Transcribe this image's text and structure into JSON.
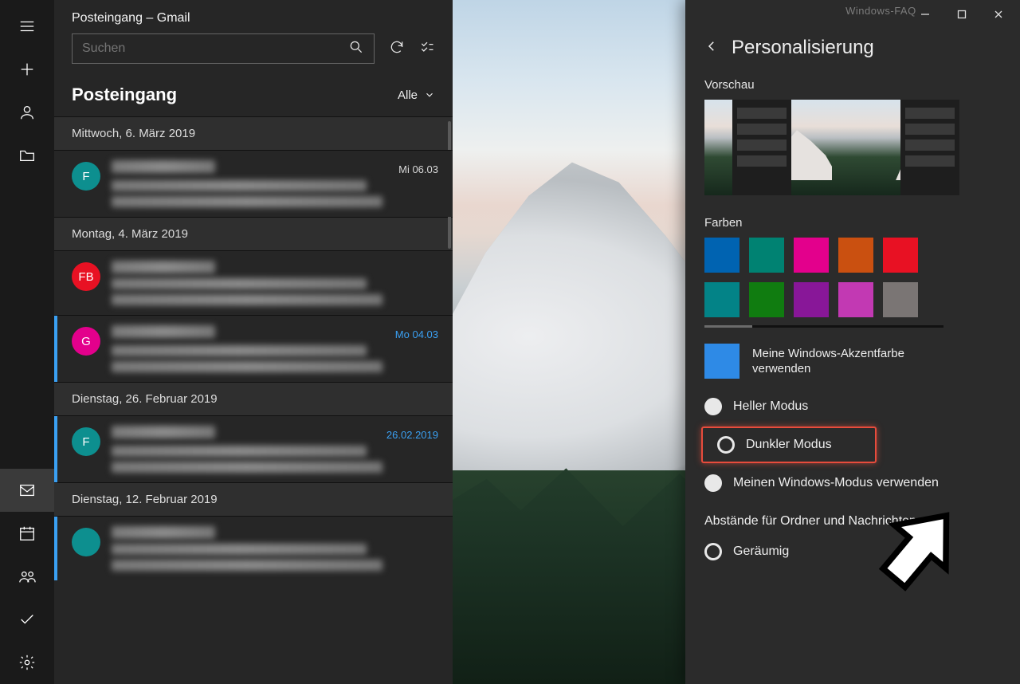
{
  "window": {
    "watermark": "Windows-FAQ"
  },
  "nav": {
    "items": [
      "menu",
      "compose",
      "accounts",
      "folders"
    ],
    "bottom": [
      "mail",
      "calendar",
      "people",
      "todo",
      "settings"
    ],
    "active": "mail"
  },
  "list": {
    "title": "Posteingang – Gmail",
    "search_placeholder": "Suchen",
    "inbox_label": "Posteingang",
    "filter_label": "Alle",
    "groups": [
      {
        "date_label": "Mittwoch, 6. März 2019",
        "items": [
          {
            "avatar_letter": "F",
            "avatar_color": "#0d8f8f",
            "date": "Mi 06.03",
            "unread": false
          }
        ]
      },
      {
        "date_label": "Montag, 4. März 2019",
        "items": [
          {
            "avatar_letter": "FB",
            "avatar_color": "#e81123",
            "date": "",
            "unread": false
          },
          {
            "avatar_letter": "G",
            "avatar_color": "#e3008c",
            "date": "Mo 04.03",
            "unread": true
          }
        ]
      },
      {
        "date_label": "Dienstag, 26. Februar 2019",
        "items": [
          {
            "avatar_letter": "F",
            "avatar_color": "#0d8f8f",
            "date": "26.02.2019",
            "unread": true
          }
        ]
      },
      {
        "date_label": "Dienstag, 12. Februar 2019",
        "items": [
          {
            "avatar_letter": "",
            "avatar_color": "#0d8f8f",
            "date": "",
            "unread": true
          }
        ]
      }
    ]
  },
  "settings": {
    "title": "Personalisierung",
    "preview_label": "Vorschau",
    "colors_label": "Farben",
    "swatches": [
      "#0063b1",
      "#008272",
      "#e3008c",
      "#ca5010",
      "#e81123",
      "#038387",
      "#107c10",
      "#881798",
      "#c239b3",
      "#7a7574"
    ],
    "accent_label": "Meine Windows-Akzentfarbe verwenden",
    "mode_light": "Heller Modus",
    "mode_dark": "Dunkler Modus",
    "mode_windows": "Meinen Windows-Modus verwenden",
    "spacing_label": "Abstände für Ordner und Nachrichten",
    "spacing_option1": "Geräumig"
  }
}
